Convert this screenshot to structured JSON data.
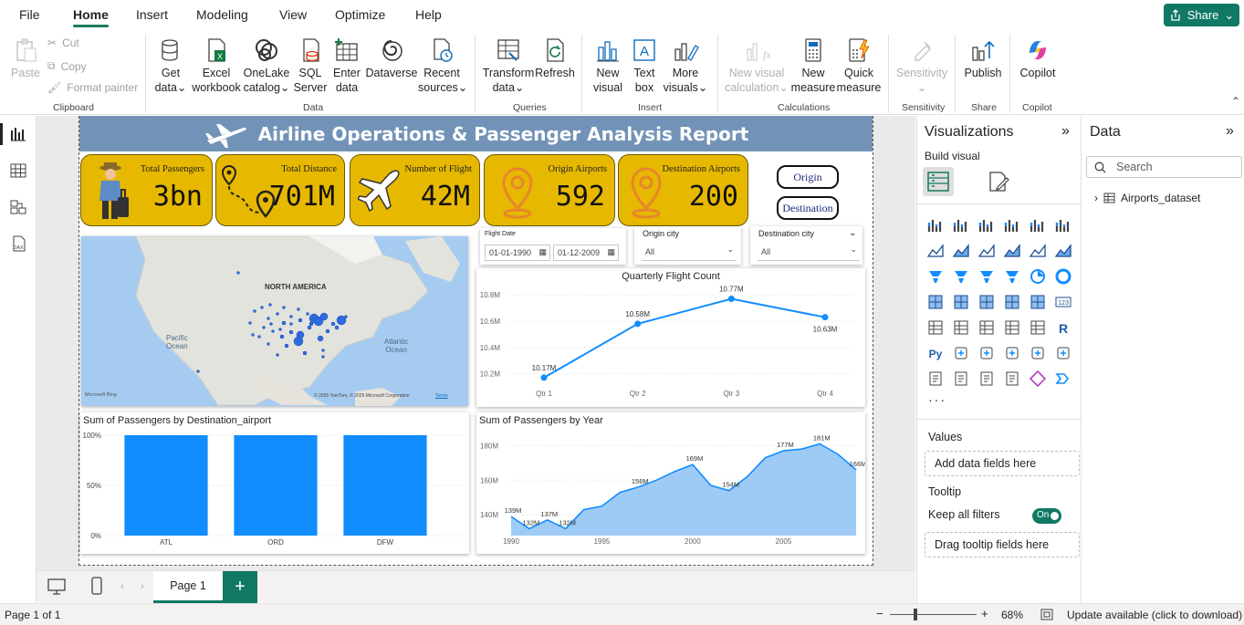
{
  "menu": {
    "items": [
      "File",
      "Home",
      "Insert",
      "Modeling",
      "View",
      "Optimize",
      "Help"
    ],
    "active": "Home",
    "share_label": "Share"
  },
  "ribbon": {
    "clipboard": {
      "paste": "Paste",
      "cut": "Cut",
      "copy": "Copy",
      "format_painter": "Format painter",
      "group": "Clipboard"
    },
    "data": {
      "get_data": [
        "Get",
        "data"
      ],
      "excel": [
        "Excel",
        "workbook"
      ],
      "onelake": [
        "OneLake",
        "catalog"
      ],
      "sql": [
        "SQL",
        "Server"
      ],
      "enter": [
        "Enter",
        "data"
      ],
      "dataverse": "Dataverse",
      "recent": [
        "Recent",
        "sources"
      ],
      "group": "Data"
    },
    "queries": {
      "transform": [
        "Transform",
        "data"
      ],
      "refresh": "Refresh",
      "group": "Queries"
    },
    "insert": {
      "new_visual": [
        "New",
        "visual"
      ],
      "text_box": [
        "Text",
        "box"
      ],
      "more_visuals": [
        "More",
        "visuals"
      ],
      "group": "Insert"
    },
    "calculations": {
      "new_visual_calc": [
        "New visual",
        "calculation"
      ],
      "new_measure": [
        "New",
        "measure"
      ],
      "quick_measure": [
        "Quick",
        "measure"
      ],
      "group": "Calculations"
    },
    "sensitivity": {
      "label": "Sensitivity",
      "group": "Sensitivity"
    },
    "share": {
      "publish": "Publish",
      "group": "Share"
    },
    "copilot": {
      "label": "Copilot",
      "group": "Copilot"
    }
  },
  "report": {
    "title": "Airline Operations & Passenger Analysis Report",
    "kpis": [
      {
        "label": "Total Passengers",
        "value": "3bn"
      },
      {
        "label": "Total Distance",
        "value": "701M"
      },
      {
        "label": "Number of Flight",
        "value": "42M"
      },
      {
        "label": "Origin Airports",
        "value": "592"
      },
      {
        "label": "Destination Airports",
        "value": "200"
      }
    ],
    "buttons": {
      "origin": "Origin",
      "destination": "Destination"
    },
    "map": {
      "continent": "NORTH AMERICA",
      "ocean1": [
        "Pacific",
        "Ocean"
      ],
      "ocean2": [
        "Atlantic",
        "Ocean"
      ],
      "bing": "Microsoft Bing",
      "copyright": "© 2025 TomTom, © 2025 Microsoft Corporation",
      "terms": "Terms"
    },
    "slicers": {
      "date_label": "Flight Date",
      "date_from": "01-01-1990",
      "date_to": "01-12-2009",
      "origin_label": "Origin city",
      "origin_value": "All",
      "dest_label": "Destination city",
      "dest_value": "All"
    }
  },
  "chart_data": [
    {
      "type": "line",
      "title": "Quarterly Flight Count",
      "categories": [
        "Qtr 1",
        "Qtr 2",
        "Qtr 3",
        "Qtr 4"
      ],
      "values": [
        10.17,
        10.58,
        10.77,
        10.63
      ],
      "data_labels": [
        "10.17M",
        "10.58M",
        "10.77M",
        "10.63M"
      ],
      "yticks": [
        "10.2M",
        "10.4M",
        "10.6M",
        "10.8M"
      ],
      "ylim": [
        10.1,
        10.85
      ],
      "color": "#118dff"
    },
    {
      "type": "bar",
      "title": "Sum of Passengers by Destination_airport",
      "categories": [
        "ATL",
        "ORD",
        "DFW"
      ],
      "values": [
        100,
        100,
        100
      ],
      "yticks": [
        "0%",
        "50%",
        "100%"
      ],
      "ylim": [
        0,
        100
      ],
      "color": "#118dff"
    },
    {
      "type": "area",
      "title": "Sum of Passengers by Year",
      "x": [
        1990,
        1991,
        1992,
        1993,
        1994,
        1995,
        1996,
        1997,
        1998,
        1999,
        2000,
        2001,
        2002,
        2003,
        2004,
        2005,
        2006,
        2007,
        2008,
        2009
      ],
      "values": [
        139,
        132,
        137,
        132,
        143,
        145,
        153,
        156,
        160,
        165,
        169,
        157,
        154,
        162,
        173,
        177,
        178,
        181,
        175,
        166
      ],
      "data_labels": {
        "1990": "139M",
        "1991": "132M",
        "1992": "137M",
        "1993": "132M",
        "1997": "156M",
        "2000": "169M",
        "2002": "154M",
        "2005": "177M",
        "2007": "181M",
        "2009": "166M"
      },
      "xticks": [
        "1990",
        "1995",
        "2000",
        "2005"
      ],
      "yticks": [
        "140M",
        "160M",
        "180M"
      ],
      "ylim": [
        128,
        186
      ],
      "color": "#118dff"
    }
  ],
  "page": {
    "tab": "Page 1",
    "status": "Page 1 of 1",
    "zoom": "68%",
    "update": "Update available (click to download)"
  },
  "viz_pane": {
    "title": "Visualizations",
    "build": "Build visual",
    "values": "Values",
    "values_well": "Add data fields here",
    "tooltip": "Tooltip",
    "keep_filters": "Keep all filters",
    "toggle": "On",
    "tooltip_well": "Drag tooltip fields here"
  },
  "data_pane": {
    "title": "Data",
    "search_placeholder": "Search",
    "table": "Airports_dataset"
  }
}
